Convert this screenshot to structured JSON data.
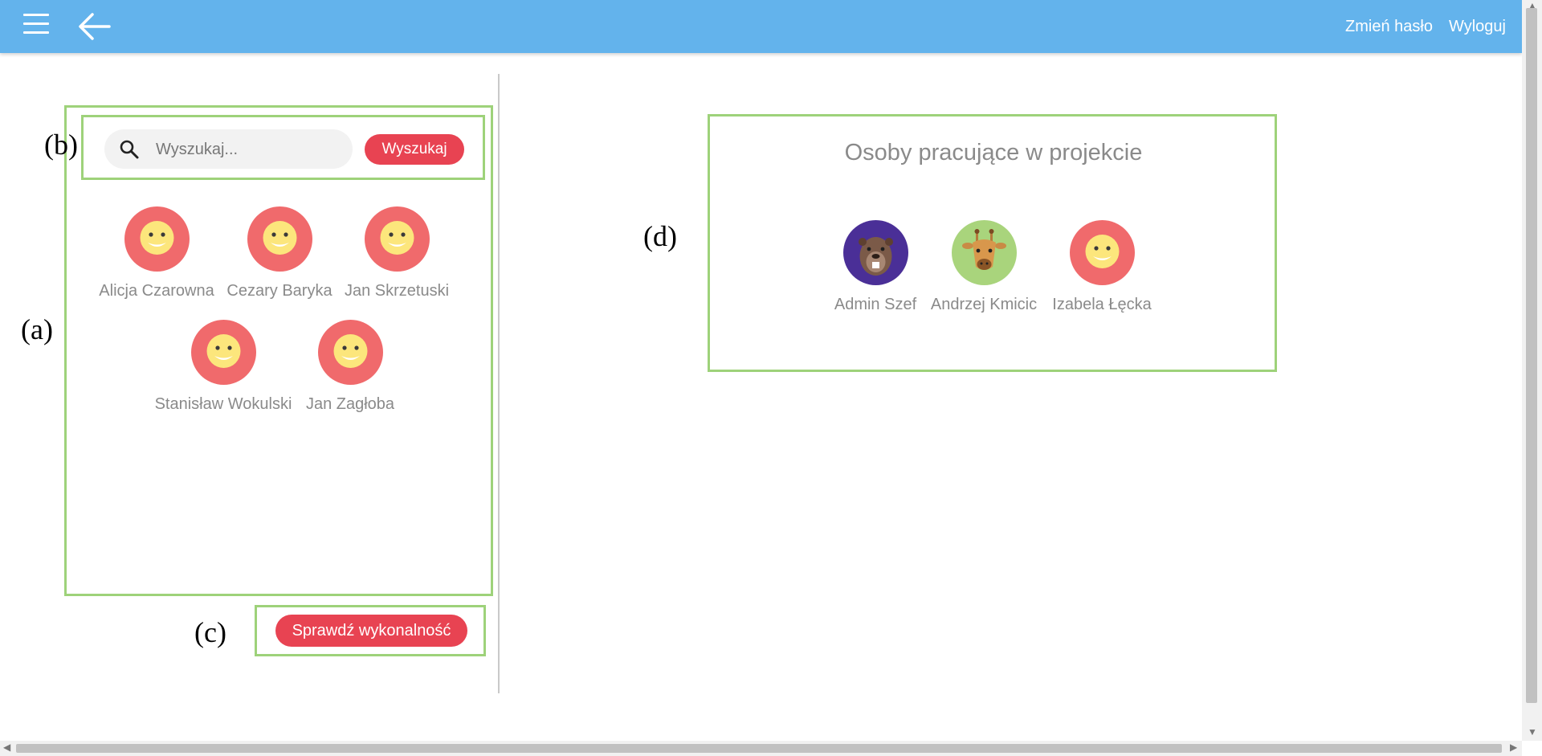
{
  "header": {
    "menu_icon": "hamburger-icon",
    "back_icon": "arrow-left-icon",
    "change_password": "Zmień hasło",
    "logout": "Wyloguj",
    "bar_color": "#63b3ec"
  },
  "annotations": {
    "a": "(a)",
    "b": "(b)",
    "c": "(c)",
    "d": "(d)",
    "box_color": "#9ed27a"
  },
  "search": {
    "placeholder": "Wyszukaj...",
    "value": "",
    "button_label": "Wyszukaj",
    "icon": "search-icon"
  },
  "available_people": [
    {
      "name": "Alicja Czarowna",
      "avatar": "smiley"
    },
    {
      "name": "Cezary Baryka",
      "avatar": "smiley"
    },
    {
      "name": "Jan Skrzetuski",
      "avatar": "smiley"
    },
    {
      "name": "Stanisław Wokulski",
      "avatar": "smiley"
    },
    {
      "name": "Jan Zagłoba",
      "avatar": "smiley"
    }
  ],
  "actions": {
    "check_performance": "Sprawdź wykonalność",
    "accent": "#e84352"
  },
  "project_panel": {
    "title": "Osoby pracujące w projekcie",
    "members": [
      {
        "name": "Admin Szef",
        "avatar": "beaver"
      },
      {
        "name": "Andrzej Kmicic",
        "avatar": "giraffe"
      },
      {
        "name": "Izabela Łęcka",
        "avatar": "smiley"
      }
    ]
  }
}
